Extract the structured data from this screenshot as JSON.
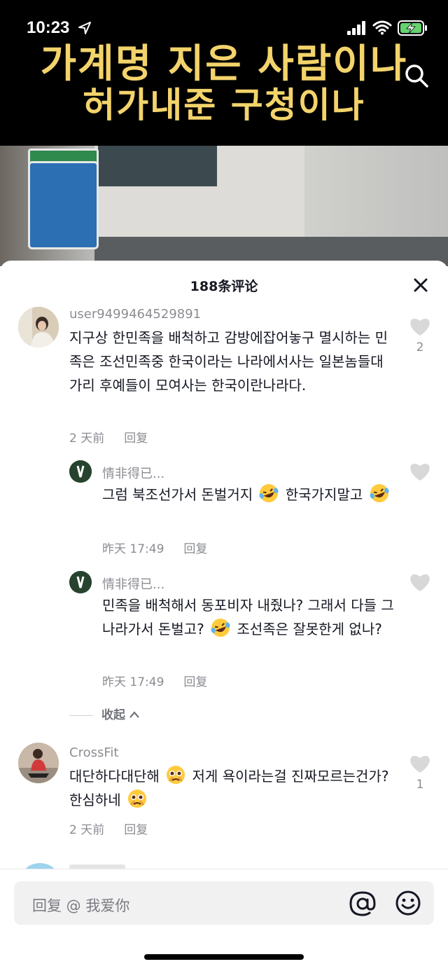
{
  "status_bar": {
    "time": "10:23"
  },
  "video": {
    "caption_line1": "가계명 지은 사람이나",
    "caption_line2": "허가내준 구청이나"
  },
  "comments_panel": {
    "title": "188条评论",
    "comments": [
      {
        "user": "user9499464529891",
        "text": "지구상 한민족을 배척하고 감방에잡어놓구 멸시하는 민족은 조선민족중 한국이라는 나라에서사는 일본놈들대가리 후예들이 모여사는 한국이란나라다.",
        "time": "2 天前",
        "reply_label": "回复",
        "likes": "2"
      },
      {
        "user": "情非得已...",
        "text_a": "그럼 북조선가서 돈벌거지",
        "text_b": "한국가지말고",
        "time": "昨天 17:49",
        "reply_label": "回复",
        "likes": ""
      },
      {
        "user": "情非得已...",
        "text_a": "민족을 배척해서 동포비자 내줬나? 그래서 다들 그나라가서 돈벌고?",
        "text_b": "조선족은 잘못한게 없나?",
        "time": "昨天 17:49",
        "reply_label": "回复",
        "likes": ""
      },
      {
        "user": "CrossFit",
        "text_a": "대단하다대단해",
        "text_b": "저게 욕이라는걸 진짜모르는건가? 한심하네",
        "time": "2 天前",
        "reply_label": "回复",
        "likes": "1"
      }
    ],
    "collapse_label": "收起"
  },
  "input_bar": {
    "placeholder": "回复 @ 我爱你"
  }
}
